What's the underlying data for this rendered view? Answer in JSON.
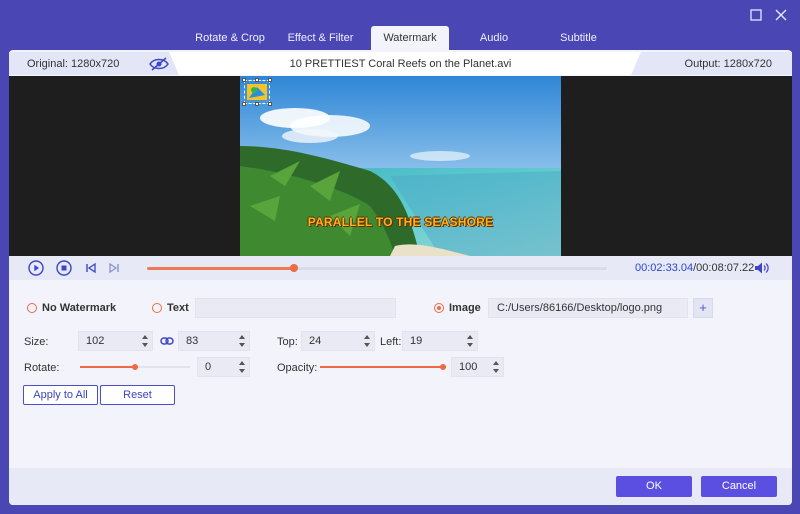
{
  "window": {
    "maximize_icon": "maximize-icon",
    "close_icon": "close-icon"
  },
  "tabs": [
    {
      "label": "Rotate & Crop",
      "active": false
    },
    {
      "label": "Effect & Filter",
      "active": false
    },
    {
      "label": "Watermark",
      "active": true
    },
    {
      "label": "Audio",
      "active": false
    },
    {
      "label": "Subtitle",
      "active": false
    }
  ],
  "info_bar": {
    "original": "Original: 1280x720",
    "filename": "10 PRETTIEST Coral Reefs on the Planet.avi",
    "output": "Output: 1280x720",
    "preview_icon": "eye-icon"
  },
  "video": {
    "caption": "PARALLEL TO THE SEASHORE",
    "watermark_icon": "logo-watermark-icon"
  },
  "player": {
    "current_time": "00:02:33.04",
    "total_time": "/00:08:07.22",
    "progress": 0.32,
    "icons": [
      "play-icon",
      "stop-icon",
      "previous-icon",
      "next-icon",
      "volume-icon"
    ]
  },
  "watermark": {
    "options": {
      "none_label": "No Watermark",
      "text_label": "Text",
      "image_label": "Image",
      "selected": "image"
    },
    "text_value": "",
    "image_path": "C:/Users/86166/Desktop/logo.png",
    "add_button": "+",
    "size_label": "Size:",
    "width": "102",
    "height": "83",
    "top_label": "Top:",
    "top": "24",
    "left_label": "Left:",
    "left": "19",
    "rotate_label": "Rotate:",
    "rotate": "0",
    "rotate_level": 0.5,
    "opacity_label": "Opacity:",
    "opacity": "100",
    "opacity_level": 1.0,
    "apply_all": "Apply to All",
    "reset": "Reset"
  },
  "footer": {
    "ok": "OK",
    "cancel": "Cancel"
  },
  "colors": {
    "frame": "#4a47b4",
    "accent": "#ee6a45",
    "primary_button": "#5a4fe0",
    "time": "#2c46d0"
  }
}
